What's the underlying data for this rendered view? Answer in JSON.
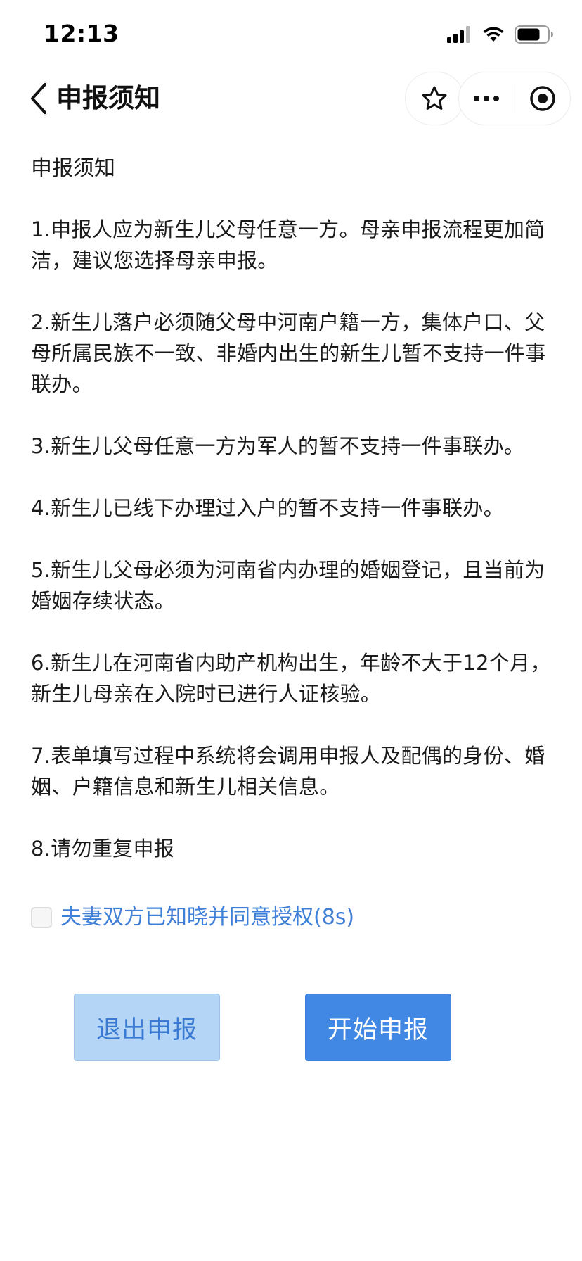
{
  "status_bar": {
    "time": "12:13",
    "icons": [
      "signal-icon",
      "wifi-icon",
      "battery-icon"
    ]
  },
  "nav": {
    "title": "申报须知",
    "icons": [
      "back-icon",
      "star-icon",
      "more-icon",
      "target-icon"
    ]
  },
  "content": {
    "section_title": "申报须知",
    "items": [
      "1.申报人应为新生儿父母任意一方。母亲申报流程更加简洁，建议您选择母亲申报。",
      "2.新生儿落户必须随父母中河南户籍一方，集体户口、父母所属民族不一致、非婚内出生的新生儿暂不支持一件事联办。",
      "3.新生儿父母任意一方为军人的暂不支持一件事联办。",
      "4.新生儿已线下办理过入户的暂不支持一件事联办。",
      "5.新生儿父母必须为河南省内办理的婚姻登记，且当前为婚姻存续状态。",
      "6.新生儿在河南省内助产机构出生，年龄不大于12个月，新生儿母亲在入院时已进行人证核验。",
      "7.表单填写过程中系统将会调用申报人及配偶的身份、婚姻、户籍信息和新生儿相关信息。",
      "8.请勿重复申报"
    ]
  },
  "consent": {
    "label": "夫妻双方已知晓并同意授权(8s)",
    "checked": false
  },
  "buttons": {
    "exit_label": "退出申报",
    "start_label": "开始申报"
  },
  "colors": {
    "accent": "#4088e4",
    "accent_light": "#b5d5f6",
    "link_text": "#3f7fd8"
  }
}
